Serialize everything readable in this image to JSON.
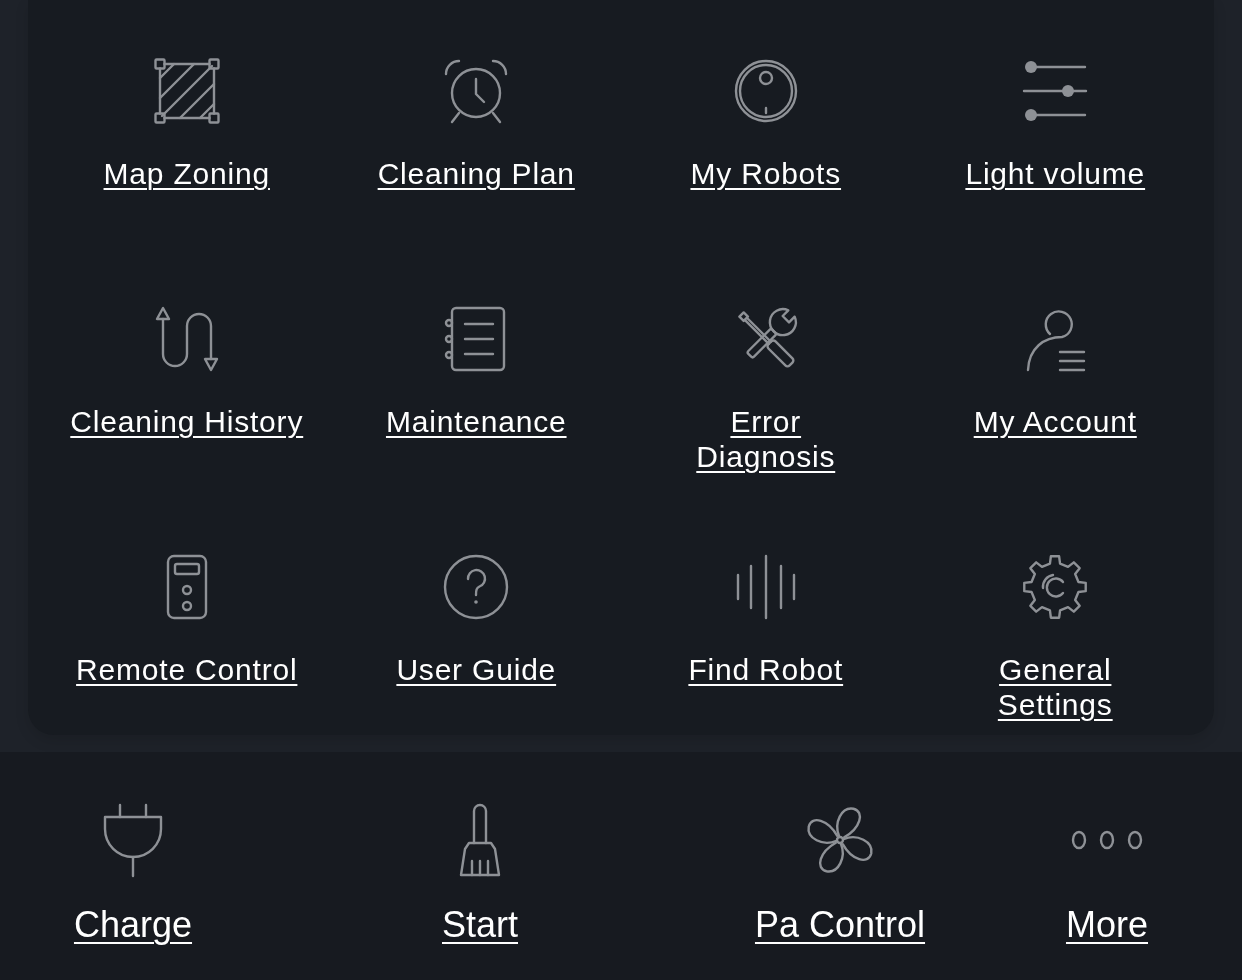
{
  "menu": {
    "items": [
      {
        "label": "Map Zoning"
      },
      {
        "label": "Cleaning Plan"
      },
      {
        "label": "My Robots"
      },
      {
        "label": "Light volume"
      },
      {
        "label": "Cleaning History"
      },
      {
        "label": "Maintenance"
      },
      {
        "label": "Error\nDiagnosis"
      },
      {
        "label": "My Account"
      },
      {
        "label": "Remote Control"
      },
      {
        "label": "User Guide"
      },
      {
        "label": "Find Robot"
      },
      {
        "label": "General\nSettings"
      }
    ]
  },
  "action_bar": {
    "items": [
      {
        "label": "Charge"
      },
      {
        "label": "Start"
      },
      {
        "label": "Pa Control"
      },
      {
        "label": "More"
      }
    ]
  }
}
